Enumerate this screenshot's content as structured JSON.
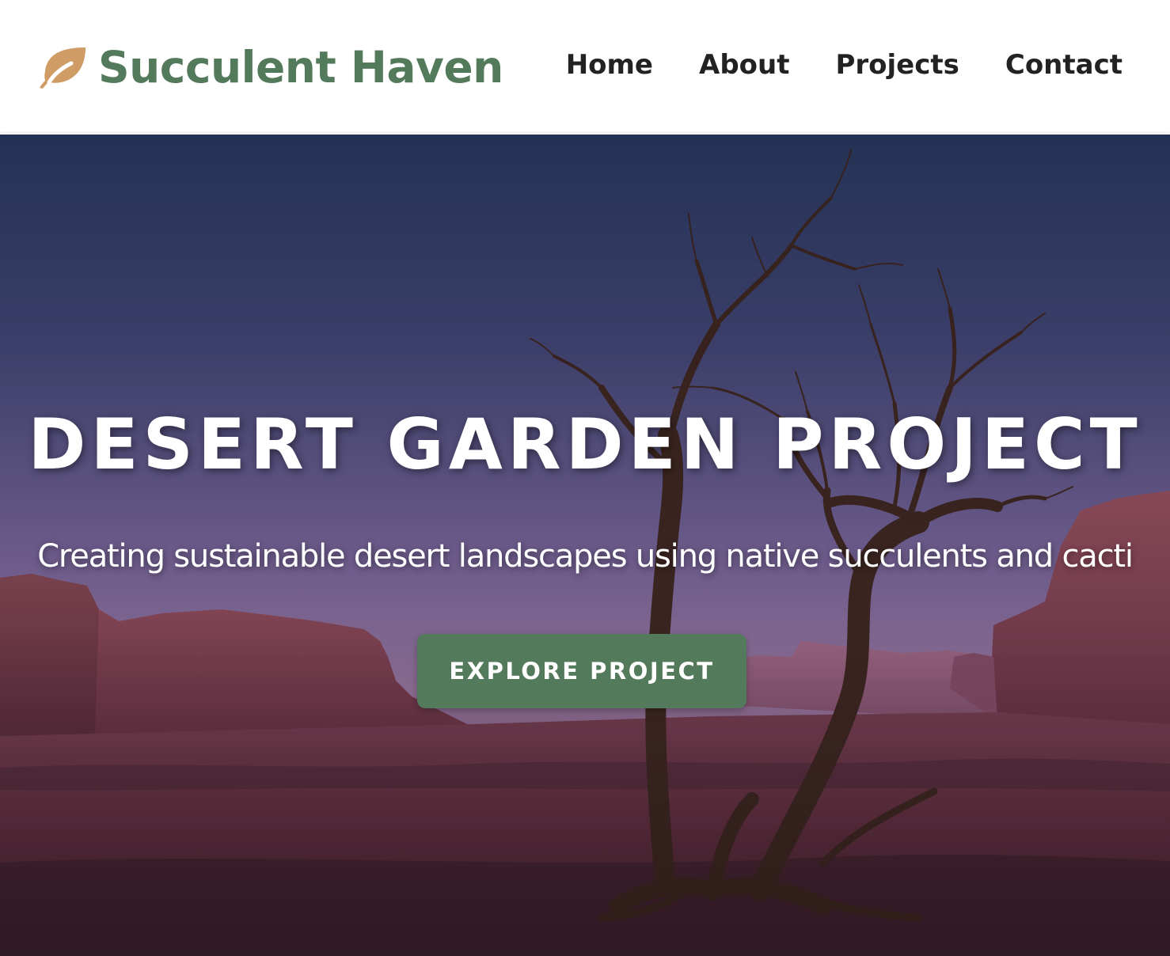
{
  "header": {
    "logo_icon": "leaf-icon",
    "brand_name": "Succulent Haven",
    "nav": [
      {
        "label": "Home"
      },
      {
        "label": "About"
      },
      {
        "label": "Projects"
      },
      {
        "label": "Contact"
      }
    ]
  },
  "hero": {
    "title": "DESERT GARDEN PROJECT",
    "subtitle": "Creating sustainable desert landscapes using native succulents and cacti",
    "cta_label": "EXPLORE PROJECT",
    "background": "desert-landscape-with-dead-tree"
  },
  "colors": {
    "brand_green": "#547a5c",
    "logo_icon": "#cf9c66",
    "nav_text": "#222222",
    "hero_text": "#ffffff"
  }
}
